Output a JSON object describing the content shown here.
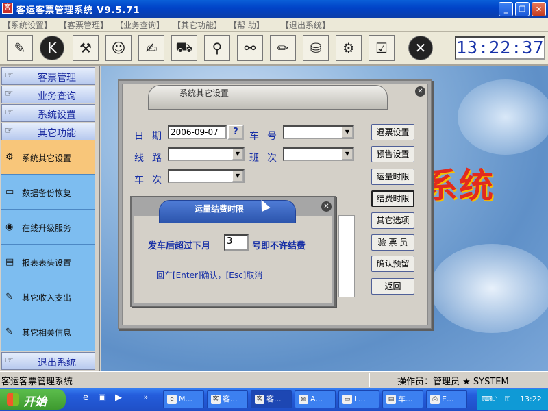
{
  "window": {
    "title": "客运客票管理系统 V9.5.71",
    "app_icon": "ticket-app-icon",
    "minimize": "_",
    "restore": "❐",
    "close": "✕"
  },
  "menu": [
    "【系统设置】",
    "【客票管理】",
    "【业务查询】",
    "【其它功能】",
    "【帮  助】",
    "【退出系统】"
  ],
  "toolbar": {
    "buttons": [
      {
        "icon": "settings-icon",
        "glyph": "✎"
      },
      {
        "icon": "k-icon",
        "glyph": "K"
      },
      {
        "icon": "tools-icon",
        "glyph": "⚒"
      },
      {
        "icon": "user-icon",
        "glyph": "☺"
      },
      {
        "icon": "document-icon",
        "glyph": "✍"
      },
      {
        "icon": "bus-icon",
        "glyph": "⛟"
      },
      {
        "icon": "magnifier-icon",
        "glyph": "⚲"
      },
      {
        "icon": "search-people-icon",
        "glyph": "⚯"
      },
      {
        "icon": "edit-icon",
        "glyph": "✏"
      },
      {
        "icon": "network-icon",
        "glyph": "⛁"
      },
      {
        "icon": "connect-icon",
        "glyph": "⚙"
      },
      {
        "icon": "checklist-icon",
        "glyph": "☑"
      },
      {
        "icon": "exit-icon",
        "glyph": "✕"
      }
    ],
    "clock": "13:22:37"
  },
  "nav": {
    "groups": [
      "客票管理",
      "业务查询",
      "系统设置",
      "其它功能"
    ],
    "items": [
      {
        "label": "系统其它设置",
        "icon": "settings-icon",
        "glyph": "⚙",
        "active": true
      },
      {
        "label": "数据备份恢复",
        "icon": "backup-icon",
        "glyph": "▭",
        "active": false
      },
      {
        "label": "在线升级服务",
        "icon": "globe-icon",
        "glyph": "◉",
        "active": false
      },
      {
        "label": "报表表头设置",
        "icon": "folder-icon",
        "glyph": "▤",
        "active": false
      },
      {
        "label": "其它收入支出",
        "icon": "income-icon",
        "glyph": "✎",
        "active": false
      },
      {
        "label": "其它相关信息",
        "icon": "info-icon",
        "glyph": "✎",
        "active": false
      }
    ],
    "exit_group": "退出系统"
  },
  "main": {
    "background_text": "系统"
  },
  "dialog": {
    "title": "系统其它设置",
    "fields": {
      "date_label": "日期",
      "date_value": "2006-09-07",
      "query_button": "?",
      "vehicle_label": "车号",
      "route_label": "线路",
      "shift_label": "班次",
      "trip_label": "车次"
    },
    "buttons": [
      "退票设置",
      "预售设置",
      "运量时限",
      "结费时限",
      "其它选项",
      "验 票 员",
      "确认预留",
      "返回"
    ],
    "focused_button": "结费时限"
  },
  "subdialog": {
    "title": "运量结费时限",
    "question_prefix": "发车后超过下月",
    "value": "3",
    "question_suffix": "号即不许结费",
    "hint": "回车[Enter]确认，[Esc]取消"
  },
  "statusbar": {
    "left": "客运客票管理系统",
    "right": "操作员：管理员 ★ SYSTEM"
  },
  "taskbar": {
    "start": "开始",
    "quicklaunch": [
      "ie-icon",
      "media-icon",
      "play-icon"
    ],
    "overflow": "»",
    "tasks": [
      {
        "label": "M...",
        "icon": "ie-icon",
        "active": false
      },
      {
        "label": "客...",
        "icon": "app-icon",
        "active": false
      },
      {
        "label": "客...",
        "icon": "ticket-app-icon",
        "active": true
      },
      {
        "label": "A...",
        "icon": "image-icon",
        "active": false
      },
      {
        "label": "L...",
        "icon": "folder-icon",
        "active": false
      },
      {
        "label": "车...",
        "icon": "doc-icon",
        "active": false
      },
      {
        "label": "E...",
        "icon": "printer-icon",
        "active": false
      }
    ],
    "clock": "13:22"
  }
}
